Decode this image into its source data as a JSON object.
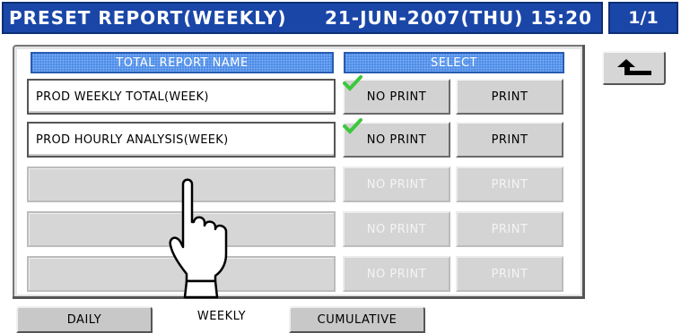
{
  "header": {
    "title": "PRESET REPORT(WEEKLY)",
    "datetime": "21-JUN-2007(THU) 15:20",
    "page": "1/1"
  },
  "table": {
    "col_name_header": "TOTAL REPORT NAME",
    "col_select_header": "SELECT",
    "rows": [
      {
        "name": "PROD WEEKLY TOTAL(WEEK)",
        "no_print": "NO PRINT",
        "print": "PRINT",
        "selected": "NO PRINT"
      },
      {
        "name": "PROD HOURLY ANALYSIS(WEEK)",
        "no_print": "NO PRINT",
        "print": "PRINT",
        "selected": "NO PRINT"
      },
      {
        "name": "",
        "no_print": "NO PRINT",
        "print": "PRINT"
      },
      {
        "name": "",
        "no_print": "NO PRINT",
        "print": "PRINT"
      },
      {
        "name": "",
        "no_print": "NO PRINT",
        "print": "PRINT"
      }
    ]
  },
  "tabs": [
    "DAILY",
    "WEEKLY",
    "CUMULATIVE"
  ],
  "active_tab": "WEEKLY",
  "icons": {
    "back": "back-arrow-icon",
    "check": "checkmark-icon",
    "hand": "pointing-hand-icon"
  },
  "colors": {
    "title_bar": "#1a46a8",
    "column_header": "#4e8ce6",
    "check": "#3cc83c"
  }
}
